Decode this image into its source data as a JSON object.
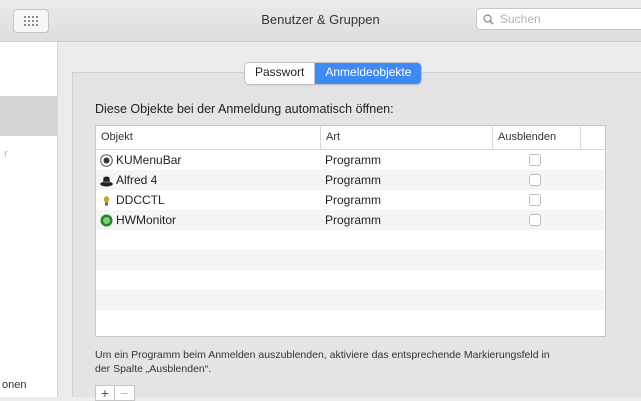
{
  "window": {
    "title": "Benutzer & Gruppen",
    "search_placeholder": "Suchen"
  },
  "sidebar": {
    "bottom_label_fragment": "onen",
    "mid_fragment": "r"
  },
  "tabs": [
    {
      "label": "Passwort",
      "active": false
    },
    {
      "label": "Anmeldeobjekte",
      "active": true
    }
  ],
  "login_items": {
    "intro": "Diese Objekte bei der Anmeldung automatisch öffnen:",
    "columns": [
      "Objekt",
      "Art",
      "Ausblenden"
    ],
    "rows": [
      {
        "name": "KUMenuBar",
        "type": "Programm",
        "hidden": false,
        "icon": "kumenubar-icon"
      },
      {
        "name": "Alfred 4",
        "type": "Programm",
        "hidden": false,
        "icon": "alfred-icon"
      },
      {
        "name": "DDCCTL",
        "type": "Programm",
        "hidden": false,
        "icon": "ddcctl-icon"
      },
      {
        "name": "HWMonitor",
        "type": "Programm",
        "hidden": false,
        "icon": "hwmonitor-icon"
      }
    ],
    "note": "Um ein Programm beim Anmelden auszublenden, aktiviere das entsprechende Markierungsfeld in der Spalte „Ausblenden“.",
    "add_label": "+",
    "remove_label": "−"
  },
  "colors": {
    "accent": "#3d8af7"
  }
}
